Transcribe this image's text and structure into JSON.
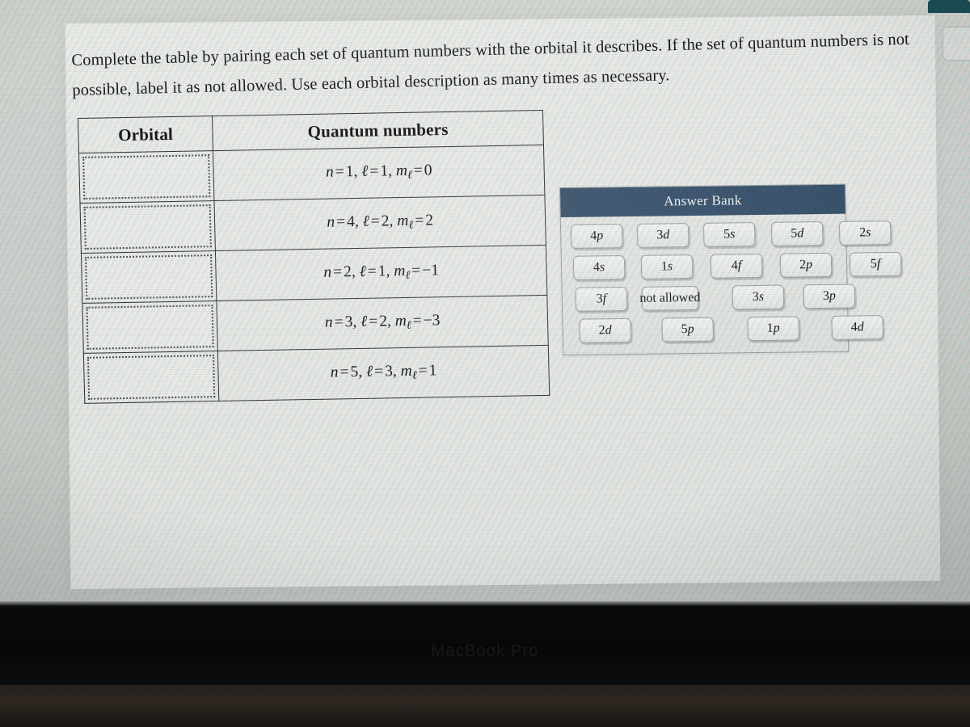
{
  "device": {
    "brand_label": "MacBook Pro"
  },
  "prompt": {
    "text": "Complete the table by pairing each set of quantum numbers with the orbital it describes. If the set of quantum numbers is not possible, label it as not allowed. Use each orbital description as many times as necessary."
  },
  "table": {
    "headers": {
      "orbital": "Orbital",
      "quantum_numbers": "Quantum numbers"
    },
    "rows": [
      {
        "orbital": "",
        "n": "1",
        "l": "1",
        "ml": "0",
        "quantum_numbers": "n = 1, ℓ = 1, mℓ = 0"
      },
      {
        "orbital": "",
        "n": "4",
        "l": "2",
        "ml": "2",
        "quantum_numbers": "n = 4, ℓ = 2, mℓ = 2"
      },
      {
        "orbital": "",
        "n": "2",
        "l": "1",
        "ml": "−1",
        "quantum_numbers": "n = 2, ℓ = 1, mℓ = −1"
      },
      {
        "orbital": "",
        "n": "3",
        "l": "2",
        "ml": "−3",
        "quantum_numbers": "n = 3, ℓ = 2, mℓ = −3"
      },
      {
        "orbital": "",
        "n": "5",
        "l": "3",
        "ml": "1",
        "quantum_numbers": "n = 5, ℓ = 3, mℓ = 1"
      }
    ]
  },
  "answer_bank": {
    "title": "Answer Bank",
    "header_color": "#37506b",
    "rows": [
      [
        {
          "label": "4p",
          "n": "4",
          "l": "p"
        },
        {
          "label": "3d",
          "n": "3",
          "l": "d"
        },
        {
          "label": "5s",
          "n": "5",
          "l": "s"
        },
        {
          "label": "5d",
          "n": "5",
          "l": "d"
        },
        {
          "label": "2s",
          "n": "2",
          "l": "s"
        }
      ],
      [
        {
          "label": "4s",
          "n": "4",
          "l": "s"
        },
        {
          "label": "1s",
          "n": "1",
          "l": "s"
        },
        {
          "label": "4f",
          "n": "4",
          "l": "f"
        },
        {
          "label": "2p",
          "n": "2",
          "l": "p"
        },
        {
          "label": "5f",
          "n": "5",
          "l": "f"
        }
      ],
      [
        {
          "label": "3f",
          "n": "3",
          "l": "f"
        },
        {
          "label": "not allowed",
          "n": "not allowed",
          "l": ""
        },
        {
          "label": "3s",
          "n": "3",
          "l": "s"
        },
        {
          "label": "3p",
          "n": "3",
          "l": "p"
        }
      ],
      [
        {
          "label": "2d",
          "n": "2",
          "l": "d"
        },
        {
          "label": "5p",
          "n": "5",
          "l": "p"
        },
        {
          "label": "1p",
          "n": "1",
          "l": "p"
        },
        {
          "label": "4d",
          "n": "4",
          "l": "d"
        }
      ]
    ]
  }
}
